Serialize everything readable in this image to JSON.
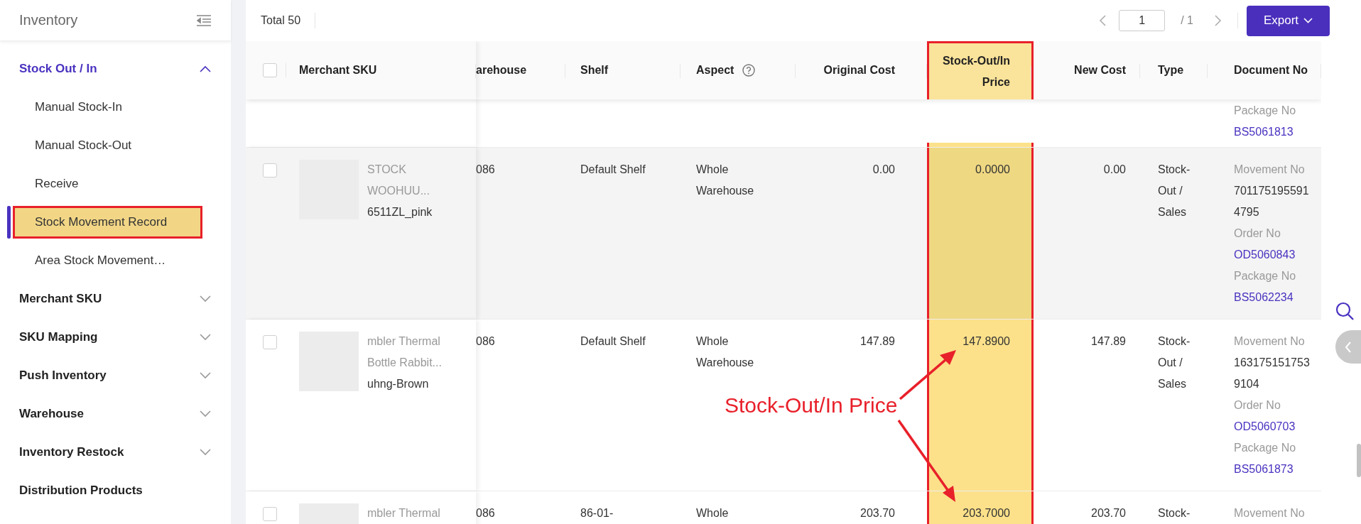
{
  "sidebar": {
    "title": "Inventory",
    "items": [
      {
        "label": "Stock Out / In",
        "expanded": true,
        "children": [
          {
            "label": "Manual Stock-In",
            "selected": false,
            "highlighted": false
          },
          {
            "label": "Manual Stock-Out",
            "selected": false,
            "highlighted": false
          },
          {
            "label": "Receive",
            "selected": false,
            "highlighted": false
          },
          {
            "label": "Stock Movement Record",
            "selected": true,
            "highlighted": true
          },
          {
            "label": "Area Stock Movement…",
            "selected": false,
            "highlighted": false
          }
        ]
      },
      {
        "label": "Merchant SKU",
        "expanded": false
      },
      {
        "label": "SKU Mapping",
        "expanded": false
      },
      {
        "label": "Push Inventory",
        "expanded": false
      },
      {
        "label": "Warehouse",
        "expanded": false
      },
      {
        "label": "Inventory Restock",
        "expanded": false
      },
      {
        "label": "Distribution Products"
      }
    ]
  },
  "toolbar": {
    "total": "Total 50",
    "page_input": "1",
    "page_total": "/ 1",
    "export_button": "Export"
  },
  "table": {
    "header_checked": false,
    "columns": [
      {
        "label": "Merchant SKU",
        "help": false,
        "highlighted": false
      },
      {
        "label": "arehouse",
        "help": false,
        "highlighted": false
      },
      {
        "label": "Shelf",
        "help": false,
        "highlighted": false
      },
      {
        "label": "Aspect",
        "help": true,
        "highlighted": false
      },
      {
        "label": "Original Cost",
        "help": false,
        "highlighted": false
      },
      {
        "label": "Stock-Out/In Price",
        "help": false,
        "highlighted": true
      },
      {
        "label": "New Cost",
        "help": false,
        "highlighted": false
      },
      {
        "label": "Type",
        "help": false,
        "highlighted": false
      },
      {
        "label": "Document No",
        "help": false,
        "highlighted": false
      }
    ],
    "rows": [
      {
        "hovered": false,
        "document": [
          {
            "label": "Package No",
            "value": "BS5061813",
            "link": true
          }
        ]
      },
      {
        "hovered": true,
        "checked": false,
        "sku": {
          "name": "STOCK WOOHUU...",
          "code": "6511ZL_pink"
        },
        "cells": [
          "086",
          "Default Shelf",
          "Whole Warehouse",
          "0.00",
          "0.0000",
          "0.00",
          "Stock-Out / Sales"
        ],
        "document": [
          {
            "label": "Movement No",
            "value": "7011751955914795",
            "link": false
          },
          {
            "label": "Order No",
            "value": "OD5060843",
            "link": true
          },
          {
            "label": "Package No",
            "value": "BS5062234",
            "link": true
          }
        ]
      },
      {
        "hovered": false,
        "checked": false,
        "sku": {
          "name": "mbler Thermal Bottle Rabbit...",
          "code": "uhng-Brown"
        },
        "cells": [
          "086",
          "Default Shelf",
          "Whole Warehouse",
          "147.89",
          "147.8900",
          "147.89",
          "Stock-Out / Sales"
        ],
        "document": [
          {
            "label": "Movement No",
            "value": "1631751517539104",
            "link": false
          },
          {
            "label": "Order No",
            "value": "OD5060703",
            "link": true
          },
          {
            "label": "Package No",
            "value": "BS5061873",
            "link": true
          }
        ]
      },
      {
        "hovered": false,
        "checked": false,
        "sku": {
          "name": "mbler Thermal"
        },
        "cells": [
          "086",
          "86-01-",
          "Whole",
          "203.70",
          "203.7000",
          "203.70",
          "Stock-"
        ],
        "document": [
          {
            "label": "Movement No"
          }
        ]
      }
    ]
  },
  "annotation": {
    "label": "Stock-Out/In Price"
  }
}
